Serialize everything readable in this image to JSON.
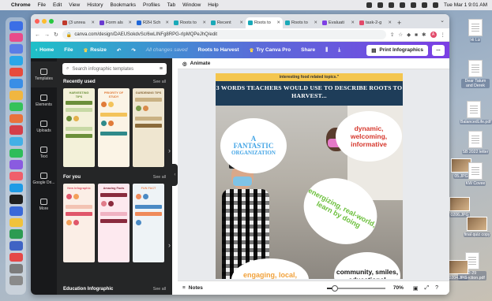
{
  "menubar": {
    "app": "Chrome",
    "items": [
      "File",
      "Edit",
      "View",
      "History",
      "Bookmarks",
      "Profiles",
      "Tab",
      "Window",
      "Help"
    ],
    "datetime": "Tue Mar 1  9:01 AM"
  },
  "tabs": [
    {
      "label": "(3 unrea",
      "color": "#c0392b"
    },
    {
      "label": "Form als",
      "color": "#6a3ad0"
    },
    {
      "label": "R2H Sch",
      "color": "#1e66d8"
    },
    {
      "label": "Roots to",
      "color": "#1aa9b8"
    },
    {
      "label": "Recent",
      "color": "#1aa9b8"
    },
    {
      "label": "Roots to",
      "color": "#1aa9b8",
      "active": true
    },
    {
      "label": "Roots to",
      "color": "#1aa9b8"
    },
    {
      "label": "Evaluati",
      "color": "#7e3fe4"
    },
    {
      "label": "task-2-g",
      "color": "#e24a6a"
    }
  ],
  "address": {
    "url": "canva.com/design/DAEUSokdvSc/6wLINFg8RPG-rIpMQPeJhQ/edit",
    "avatar": "A"
  },
  "canva_toolbar": {
    "home": "Home",
    "file": "File",
    "resize": "Resize",
    "saved_status": "All changes saved",
    "title": "Roots to Harvest",
    "try_pro": "Try Canva Pro",
    "share": "Share",
    "print": "Print Infographics",
    "more": "..."
  },
  "rail": [
    {
      "label": "Templates",
      "icon": "templates-icon"
    },
    {
      "label": "Elements",
      "icon": "elements-icon"
    },
    {
      "label": "Uploads",
      "icon": "uploads-icon"
    },
    {
      "label": "Text",
      "icon": "text-icon"
    },
    {
      "label": "Google Dri...",
      "icon": "google-drive-icon"
    },
    {
      "label": "More",
      "icon": "more-icon"
    }
  ],
  "panel": {
    "search_placeholder": "Search infographic templates",
    "recent_title": "Recently used",
    "foryou_title": "For you",
    "edu_title": "Education Infographic",
    "see_all": "See all",
    "recent_thumbs": [
      {
        "title": "HARVESTING TIPS",
        "bg": "#f3f1d9",
        "accent": "#6b8f3a"
      },
      {
        "title": "PRIORITY OF STUDY",
        "bg": "#fbf4e6",
        "accent": "#e07b39"
      },
      {
        "title": "GARDENING TIPS",
        "bg": "#efe6d0",
        "accent": "#8a6a3a"
      }
    ],
    "foryou_thumbs": [
      {
        "title": "New Infographic",
        "bg": "#fbeee6",
        "accent": "#e0566a"
      },
      {
        "title": "Amazing Facts",
        "bg": "#fde9ef",
        "accent": "#8a2b3e"
      },
      {
        "title": "FUN FACT",
        "bg": "#eef3f6",
        "accent": "#ef8a5a"
      }
    ]
  },
  "editor": {
    "animate": "Animate",
    "design": {
      "top_banner": "interesting food related topics.\"",
      "headline": "3 WORDS TEACHERS WOULD USE TO DESCRIBE ROOTS TO HARVEST...",
      "bubble1": [
        "A",
        "FANTASTIC",
        "ORGANIZATION"
      ],
      "bubble2": "dynamic, welcoming, informative",
      "bubble3": "energizing, real-world, learn by doing",
      "bubble4": "engaging, local, knowledgeabl",
      "bubble5": "community, smiles, educational"
    },
    "notes": "Notes",
    "zoom": "70%",
    "zoom_fraction": 0.1
  },
  "desktop_files": [
    {
      "label": "Hi Liz",
      "kind": "doc"
    },
    {
      "label": "Dear Tatum and Derek",
      "kind": "doc"
    },
    {
      "label": "BalancedLife.pdf",
      "kind": "doc"
    },
    {
      "label": "SB 2022 letter",
      "kind": "doc"
    },
    {
      "label": "05.JPG",
      "kind": "img"
    },
    {
      "label": "KW Covee",
      "kind": "doc"
    },
    {
      "label": "0206.JPG",
      "kind": "img"
    },
    {
      "label": "final quiz copy",
      "kind": "img"
    },
    {
      "label": "2-29 Reflection.pdf",
      "kind": "doc"
    },
    {
      "label": "0204.JPG",
      "kind": "img"
    }
  ]
}
